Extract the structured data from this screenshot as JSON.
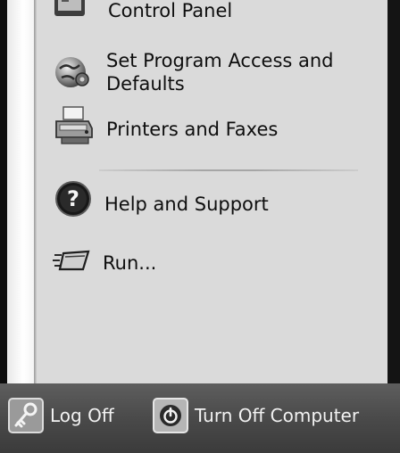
{
  "menu": {
    "items": [
      {
        "label": "Control Panel",
        "icon": "control-panel-icon"
      },
      {
        "label": "Set Program Access and Defaults",
        "icon": "set-program-access-icon"
      },
      {
        "label": "Printers and Faxes",
        "icon": "printer-icon"
      },
      {
        "label": "Help and Support",
        "icon": "help-icon"
      },
      {
        "label": "Run...",
        "icon": "run-icon"
      }
    ]
  },
  "footer": {
    "log_off_label": "Log Off",
    "turn_off_label": "Turn Off Computer"
  }
}
